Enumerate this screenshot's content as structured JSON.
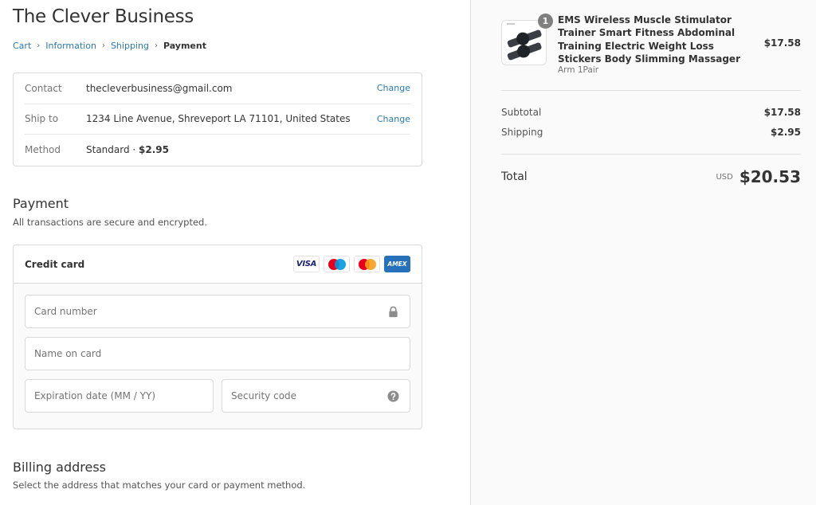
{
  "shop": {
    "title": "The Clever Business"
  },
  "breadcrumb": {
    "items": [
      "Cart",
      "Information",
      "Shipping"
    ],
    "current": "Payment",
    "separator": "›"
  },
  "review": {
    "rows": [
      {
        "label": "Contact",
        "value": "thecleverbusiness@gmail.com",
        "action": "Change"
      },
      {
        "label": "Ship to",
        "value": "1234 Line Avenue, Shreveport LA 71101, United States",
        "action": "Change"
      },
      {
        "label": "Method",
        "value_prefix": "Standard · ",
        "value_strong": "$2.95"
      }
    ]
  },
  "payment": {
    "title": "Payment",
    "subtitle": "All transactions are secure and encrypted.",
    "method_label": "Credit card",
    "brands": [
      "VISA",
      "Maestro",
      "Mastercard",
      "AMEX"
    ],
    "fields": {
      "card_number_placeholder": "Card number",
      "name_placeholder": "Name on card",
      "expiry_placeholder": "Expiration date (MM / YY)",
      "cvv_placeholder": "Security code"
    }
  },
  "billing": {
    "title": "Billing address",
    "subtitle": "Select the address that matches your card or payment method."
  },
  "summary": {
    "product": {
      "quantity": "1",
      "name": "EMS Wireless Muscle Stimulator Trainer Smart Fitness Abdominal Training Electric Weight Loss Stickers Body Slimming Massager",
      "variant": "Arm 1Pair",
      "price": "$17.58"
    },
    "subtotal_label": "Subtotal",
    "subtotal": "$17.58",
    "shipping_label": "Shipping",
    "shipping": "$2.95",
    "total_label": "Total",
    "currency": "USD",
    "total": "$20.53"
  },
  "colors": {
    "link": "#2a7ab0",
    "amex": "#2671b9",
    "maestro_red": "#eb001b",
    "maestro_blue": "#0099df",
    "mastercard_red": "#eb001b",
    "mastercard_orange": "#f79e1b"
  }
}
